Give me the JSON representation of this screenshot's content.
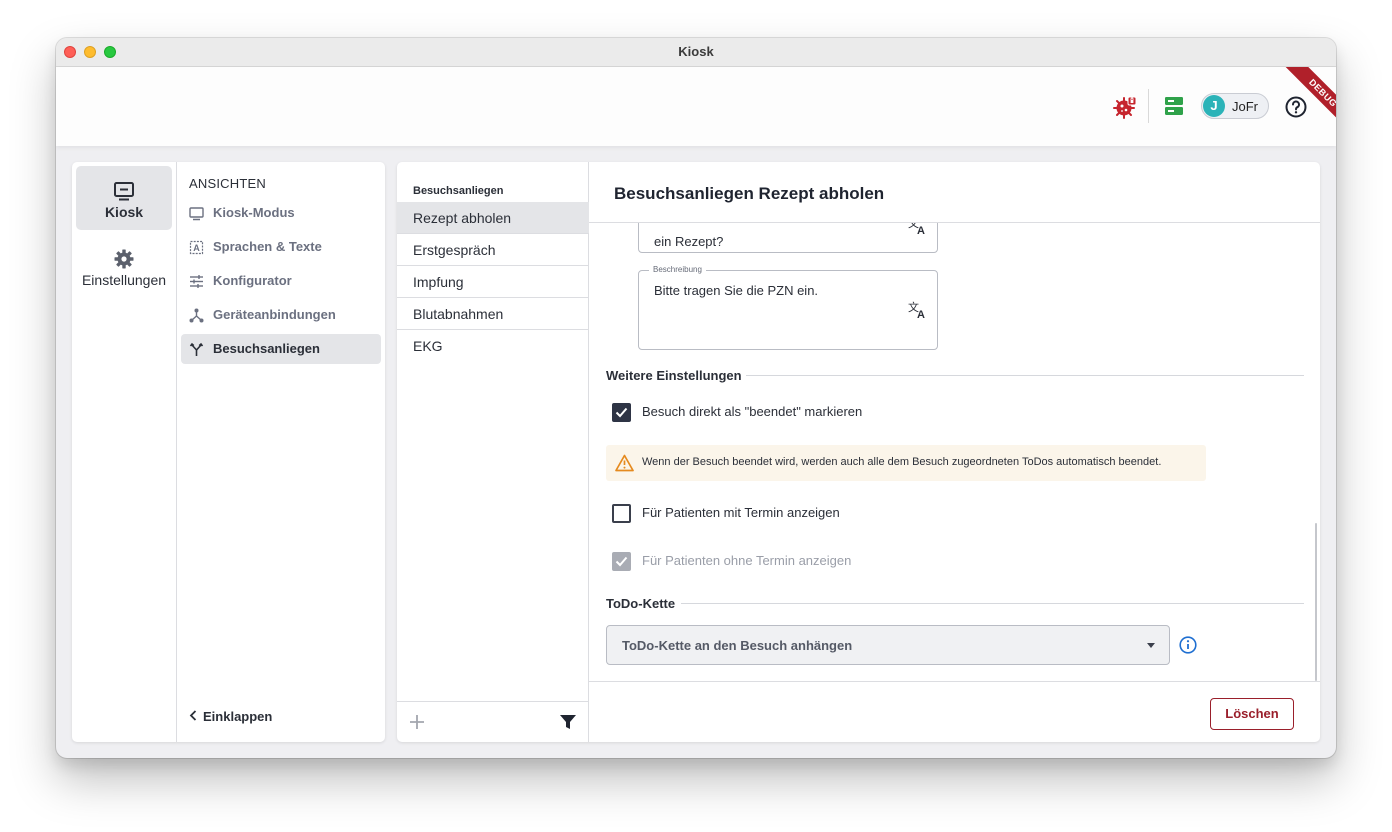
{
  "window": {
    "title": "Kiosk"
  },
  "appbar": {
    "user": {
      "initial": "J",
      "name": "JoFr"
    },
    "debug_label": "DEBUG",
    "icons": [
      "virus-alert-icon",
      "server-icon",
      "help-icon"
    ],
    "colors": {
      "virus_alert": "#c6252e",
      "server": "#2fa24a",
      "avatar": "#2bb3b8",
      "debug": "#b0202a"
    }
  },
  "rail": {
    "items": [
      {
        "label": "Kiosk",
        "icon": "monitor-icon",
        "active": true
      },
      {
        "label": "Einstellungen",
        "icon": "gear-icon",
        "active": false
      }
    ]
  },
  "nav": {
    "heading": "ANSICHTEN",
    "items": [
      {
        "label": "Kiosk-Modus",
        "icon": "monitor-icon"
      },
      {
        "label": "Sprachen & Texte",
        "icon": "translate-icon"
      },
      {
        "label": "Konfigurator",
        "icon": "sliders-icon"
      },
      {
        "label": "Geräteanbindungen",
        "icon": "network-icon"
      },
      {
        "label": "Besuchsanliegen",
        "icon": "fork-icon",
        "active": true
      }
    ],
    "collapse_label": "Einklappen"
  },
  "list": {
    "heading": "Besuchsanliegen",
    "items": [
      "Rezept abholen",
      "Erstgespräch",
      "Impfung",
      "Blutabnahmen",
      "EKG"
    ],
    "selected": "Rezept abholen"
  },
  "detail": {
    "title": "Besuchsanliegen Rezept abholen",
    "question_field": {
      "value_partial": "ein Rezept?"
    },
    "description_field": {
      "label": "Beschreibung",
      "value": "Bitte tragen Sie die PZN ein."
    },
    "further_settings": {
      "title": "Weitere Einstellungen",
      "mark_finished": {
        "label": "Besuch direkt als \"beendet\" markieren",
        "checked": true
      },
      "warning": "Wenn der Besuch beendet wird, werden auch alle dem Besuch zugeordneten ToDos automatisch beendet.",
      "with_appointment": {
        "label": "Für Patienten mit Termin anzeigen",
        "checked": false
      },
      "without_appointment": {
        "label": "Für Patienten ohne Termin anzeigen",
        "checked": true,
        "disabled": true
      }
    },
    "todo_chain": {
      "title": "ToDo-Kette",
      "select_placeholder": "ToDo-Kette an den Besuch anhängen"
    },
    "delete_label": "Löschen",
    "colors": {
      "delete": "#9a1f2b",
      "warning_bg": "#fbf5ea",
      "warning_icon": "#e58a1f",
      "info": "#1f6fd1"
    }
  }
}
